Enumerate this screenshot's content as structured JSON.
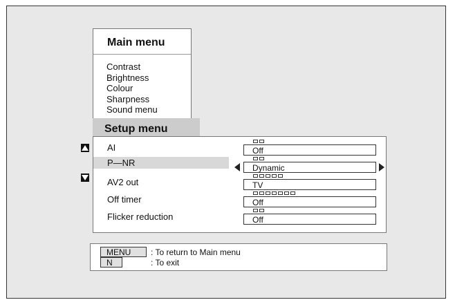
{
  "main_menu": {
    "title": "Main menu",
    "items": [
      "Contrast",
      "Brightness",
      "Colour",
      "Sharpness",
      "Sound menu"
    ]
  },
  "setup_menu": {
    "title": "Setup menu",
    "rows": [
      {
        "label": "AI",
        "value": "Off",
        "level": 2,
        "selected": false
      },
      {
        "label": "P—NR",
        "value": "Dynamic",
        "level": 2,
        "selected": true
      },
      {
        "label": "AV2 out",
        "value": "TV",
        "level": 5,
        "selected": false
      },
      {
        "label": "Off timer",
        "value": "Off",
        "level": 7,
        "selected": false
      },
      {
        "label": "Flicker reduction",
        "value": "Off",
        "level": 2,
        "selected": false
      }
    ]
  },
  "help": {
    "menu_key": "MENU",
    "menu_text": ": To return to Main menu",
    "n_key": "N",
    "n_text": ": To exit"
  },
  "icons": {
    "scroll_up": "up-triangle-icon",
    "scroll_down": "down-triangle-icon",
    "value_left": "left-arrow-icon",
    "value_right": "right-arrow-icon"
  }
}
